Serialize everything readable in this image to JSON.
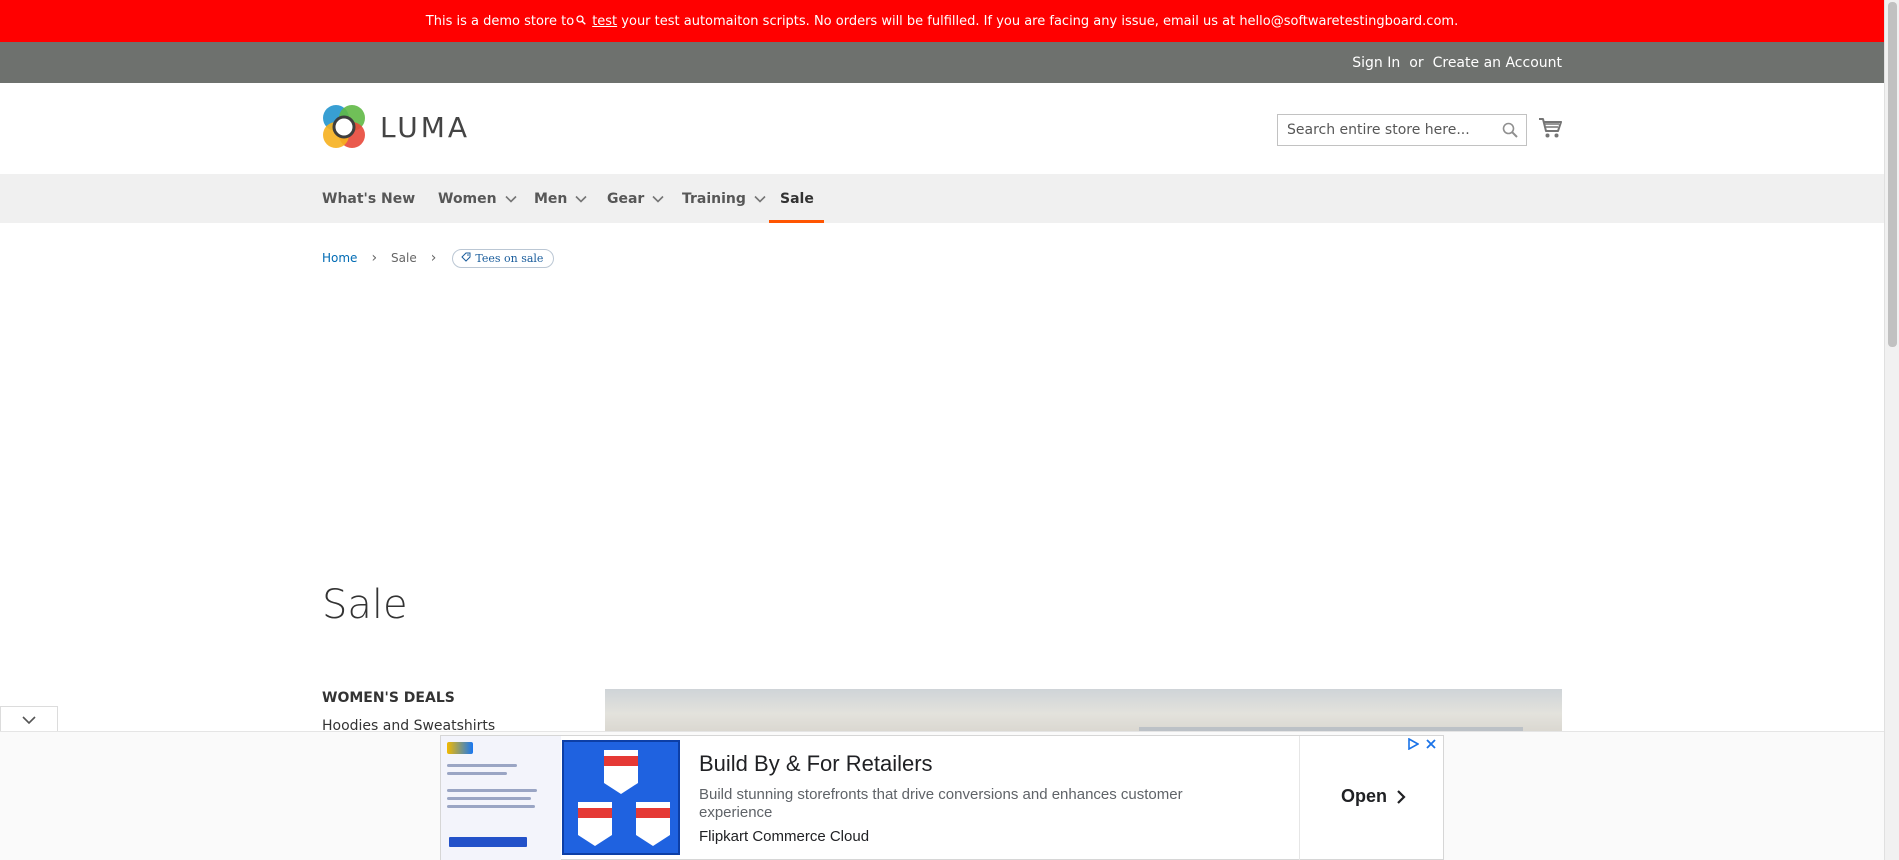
{
  "demo_banner": {
    "text_before": "This is a demo store to",
    "link_text": "test",
    "text_after": "your test automaiton scripts. No orders will be fulfilled. If you are facing any issue, email us at hello@softwaretestingboard.com."
  },
  "panel": {
    "sign_in": "Sign In",
    "or": "or",
    "create_account": "Create an Account"
  },
  "header": {
    "logo_text": "LUMA",
    "search_placeholder": "Search entire store here..."
  },
  "nav": {
    "items": [
      {
        "label": "What's New",
        "has_submenu": false
      },
      {
        "label": "Women",
        "has_submenu": true
      },
      {
        "label": "Men",
        "has_submenu": true
      },
      {
        "label": "Gear",
        "has_submenu": true
      },
      {
        "label": "Training",
        "has_submenu": true
      },
      {
        "label": "Sale",
        "has_submenu": false,
        "active": true
      }
    ]
  },
  "breadcrumb": {
    "home": "Home",
    "current": "Sale",
    "chip": "Tees on sale"
  },
  "page": {
    "title": "Sale"
  },
  "sidebar": {
    "heading": "Women's Deals",
    "links": [
      "Hoodies and Sweatshirts"
    ]
  },
  "ad": {
    "headline": "Build By & For Retailers",
    "description": "Build stunning storefronts that drive conversions and enhances customer experience",
    "brand": "Flipkart Commerce Cloud",
    "cta": "Open"
  },
  "colors": {
    "banner": "#ff0000",
    "panel": "#6e716e",
    "nav_bg": "#f0f0f0",
    "active_underline": "#ff5501",
    "link": "#006bb4"
  }
}
